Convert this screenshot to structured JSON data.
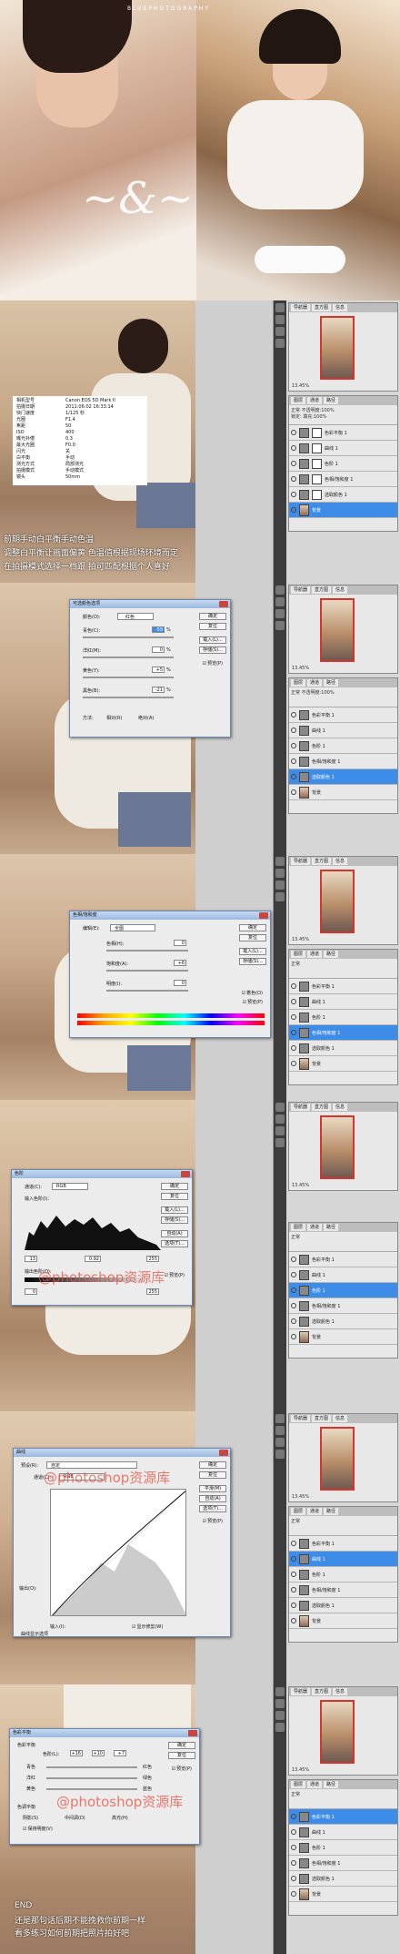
{
  "cover": {
    "brand": "BLUEPHOTOGRAPHY"
  },
  "exif": {
    "rows": [
      {
        "k": "相机型号",
        "v": "Canon EOS 5D Mark II"
      },
      {
        "k": "拍摄日期",
        "v": "2011:06:02 16:33:14"
      },
      {
        "k": "快门速度",
        "v": "1/125 秒"
      },
      {
        "k": "光圈",
        "v": "F1.4"
      },
      {
        "k": "焦距",
        "v": "50"
      },
      {
        "k": "ISO",
        "v": "400"
      },
      {
        "k": "曝光补偿",
        "v": "0.3"
      },
      {
        "k": "最大光圈",
        "v": "F0.0"
      },
      {
        "k": "闪光",
        "v": "关"
      },
      {
        "k": "白平衡",
        "v": "手动"
      },
      {
        "k": "测光方式",
        "v": "局部测光"
      },
      {
        "k": "拍摄模式",
        "v": "手动模式"
      },
      {
        "k": "镜头",
        "v": "50mm"
      }
    ]
  },
  "intro_text": {
    "line1": "前期手动白平衡手动色温",
    "line2": "调整白平衡让画面偏黄 色温值根据现场环境而定",
    "line3": "在拍摄模式选择一档跟 拍可匹配根据个人喜好"
  },
  "watermark": "@photoshop资源库",
  "layers_panel": {
    "nav_tabs": [
      "导航器",
      "直方图",
      "信息"
    ],
    "zoom": "13.45%",
    "layer_tabs": [
      "图层",
      "通道",
      "路径"
    ],
    "blend_mode": "正常",
    "opacity_label": "不透明度:",
    "opacity": "100%",
    "lock_label": "锁定:",
    "fill_label": "填充:",
    "fill": "100%",
    "layers_s1": [
      "色彩平衡 1",
      "曲线 1",
      "色阶 1",
      "色相/饱和度 1",
      "选取颜色 1",
      "背景"
    ],
    "layers_s2": [
      "色彩平衡 1",
      "曲线 1",
      "色阶 1",
      "色相/饱和度 1",
      "选取颜色 1",
      "背景"
    ],
    "layers_s3": [
      "色彩平衡 1",
      "曲线 1",
      "色阶 1",
      "色相/饱和度 1",
      "选取颜色 1",
      "背景"
    ],
    "layers_s4": [
      "色彩平衡 1",
      "曲线 1",
      "色阶 1",
      "色相/饱和度 1",
      "选取颜色 1",
      "背景"
    ],
    "layers_s5": [
      "色彩平衡 1",
      "曲线 1",
      "色阶 1",
      "色相/饱和度 1",
      "选取颜色 1",
      "背景"
    ],
    "layers_s6": [
      "色彩平衡 1",
      "曲线 1",
      "色阶 1",
      "色相/饱和度 1",
      "选取颜色 1",
      "背景"
    ]
  },
  "selective_color": {
    "title": "可选颜色选项",
    "colors_label": "颜色(O):",
    "colors_value": "红色",
    "cyan_label": "青色(C):",
    "cyan": "-59",
    "pct": "%",
    "magenta_label": "洋红(M):",
    "magenta": "0",
    "yellow_label": "黄色(Y):",
    "yellow": "+5",
    "black_label": "黑色(B):",
    "black": "-21",
    "method_label": "方法:",
    "method_rel": "相对(R)",
    "method_abs": "绝对(A)",
    "ok": "确定",
    "reset": "复位",
    "load": "载入(L)...",
    "save": "存储(S)...",
    "preview": "预览(P)"
  },
  "hue_sat": {
    "title": "色相/饱和度",
    "edit_label": "编辑(E):",
    "edit_value": "全图",
    "hue_label": "色相(H):",
    "hue": "0",
    "sat_label": "饱和度(A):",
    "sat": "+6",
    "light_label": "明度(I):",
    "light": "0",
    "colorize": "着色(O)",
    "preview": "预览(P)",
    "ok": "确定",
    "reset": "复位",
    "load": "载入(L)...",
    "save": "存储(S)..."
  },
  "levels": {
    "title": "色阶",
    "channel_label": "通道(C):",
    "channel": "RGB",
    "input_label": "输入色阶(I):",
    "in_black": "13",
    "in_gamma": "0.92",
    "in_white": "255",
    "output_label": "输出色阶(O):",
    "out_black": "0",
    "out_white": "255",
    "ok": "确定",
    "reset": "复位",
    "load": "载入(L)...",
    "save": "存储(S)...",
    "auto": "自动(A)",
    "options": "选项(T)...",
    "preview": "预览(P)"
  },
  "curves": {
    "title": "曲线",
    "preset_label": "预设(R):",
    "preset": "自定",
    "channel_label": "通道(C):",
    "channel": "RGB",
    "output_label": "输出(O):",
    "input_label": "输入(I):",
    "show_clip": "显示修剪(W)",
    "options": "曲线显示选项",
    "ok": "确定",
    "reset": "复位",
    "smooth": "平滑(M)",
    "auto": "自动(A)",
    "opts": "选项(T)...",
    "preview": "预览(P)"
  },
  "color_balance": {
    "title": "色彩平衡",
    "section": "色彩平衡",
    "levels_label": "色阶(L):",
    "v1": "+16",
    "v2": "+10",
    "v3": "+7",
    "cyan": "青色",
    "red": "红色",
    "magenta": "洋红",
    "green": "绿色",
    "yellow": "黄色",
    "blue": "蓝色",
    "tone_section": "色调平衡",
    "shadows": "阴影(S)",
    "midtones": "中间调(D)",
    "highlights": "高光(H)",
    "preserve": "保持明度(V)",
    "ok": "确定",
    "reset": "复位",
    "preview": "预览(P)"
  },
  "ending": {
    "end": "END",
    "line1": "还是那句话后期不能挽救你前期一样",
    "line2": "看多练习如何前期把照片拍好吧"
  },
  "colors": {
    "accent_blue": "#3c8ce8",
    "watermark_red": "#e85041"
  }
}
